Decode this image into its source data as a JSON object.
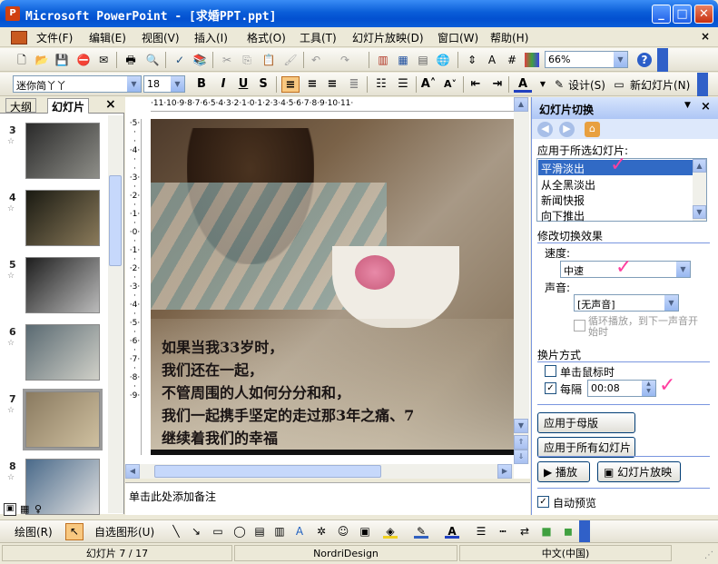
{
  "window": {
    "title": "Microsoft PowerPoint - [求婚PPT.ppt]",
    "minimize": "_",
    "maximize": "□",
    "close": "✕"
  },
  "menu": [
    "文件(F)",
    "编辑(E)",
    "视图(V)",
    "插入(I)",
    "格式(O)",
    "工具(T)",
    "幻灯片放映(D)",
    "窗口(W)",
    "帮助(H)"
  ],
  "menu_close": "×",
  "toolbar": {
    "zoom": "66%",
    "font": "迷你简丫丫",
    "size": "18",
    "bold": "B",
    "italic": "I",
    "underline": "U",
    "shadow": "S",
    "design": "设计(S)",
    "new_slide": "新幻灯片(N)"
  },
  "left_pane": {
    "tab_outline": "大纲",
    "tab_slides": "幻灯片",
    "close": "×",
    "slides": [
      {
        "num": "3",
        "colors": [
          "#2a2a2a",
          "#8e8e88"
        ]
      },
      {
        "num": "4",
        "colors": [
          "#1a1a12",
          "#8a7a5a"
        ]
      },
      {
        "num": "5",
        "colors": [
          "#1e1e1e",
          "#bbbbbb"
        ]
      },
      {
        "num": "6",
        "colors": [
          "#5a6a72",
          "#d0d0c8"
        ]
      },
      {
        "num": "7",
        "colors": [
          "#8a7a60",
          "#cfc0a0"
        ]
      },
      {
        "num": "8",
        "colors": [
          "#4a6a8a",
          "#e0e0e0"
        ]
      }
    ]
  },
  "slide": {
    "lines": [
      "如果当我33岁时，",
      "我们还在一起，",
      "不管周围的人如何分分和和，",
      "我们一起携手坚定的走过那3年之痛、7",
      "继续着我们的幸福"
    ]
  },
  "ruler_top": "·11·10·9·8·7·6·5·4·3·2·1·0·1·2·3·4·5·6·7·8·9·10·11·",
  "notes": {
    "placeholder": "单击此处添加备注"
  },
  "task_pane": {
    "title": "幻灯片切换",
    "apply_label": "应用于所选幻灯片:",
    "transitions": [
      "平滑淡出",
      "从全黑淡出",
      "新闻快报",
      "向下推出"
    ],
    "selected_transition": "平滑淡出",
    "modify_label": "修改切换效果",
    "speed_label": "速度:",
    "speed_value": "中速",
    "sound_label": "声音:",
    "sound_value": "[无声音]",
    "loop_label": "循环播放，到下一声音开始时",
    "advance_label": "换片方式",
    "on_click_label": "单击鼠标时",
    "every_label": "每隔",
    "every_value": "00:08",
    "apply_master": "应用于母版",
    "apply_all": "应用于所有幻灯片",
    "play": "播放",
    "slideshow": "幻灯片放映",
    "autopreview": "自动预览"
  },
  "drawbar": {
    "draw": "绘图(R)",
    "autoshapes": "自选图形(U)"
  },
  "status": {
    "slide": "幻灯片 7 / 17",
    "design": "NordriDesign",
    "language": "中文(中国)"
  }
}
